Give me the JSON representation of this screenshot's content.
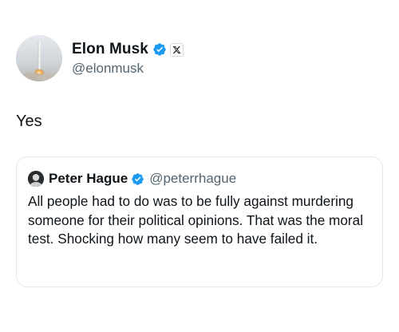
{
  "post": {
    "author": {
      "display_name": "Elon Musk",
      "handle": "@elonmusk",
      "verified_icon": "verified-badge-icon",
      "affiliation_icon": "x-logo-icon"
    },
    "text": "Yes"
  },
  "quoted_post": {
    "author": {
      "display_name": "Peter Hague",
      "handle": "@peterrhague",
      "verified_icon": "verified-badge-icon"
    },
    "text": "All people had to do was to be fully against murdering someone for their political opinions. That was the moral test. Shocking how many seem to have failed it."
  },
  "colors": {
    "verified_blue": "#1d9bf0",
    "text_primary": "#0f1419",
    "text_secondary": "#536471",
    "card_border": "#e4e9ec"
  }
}
